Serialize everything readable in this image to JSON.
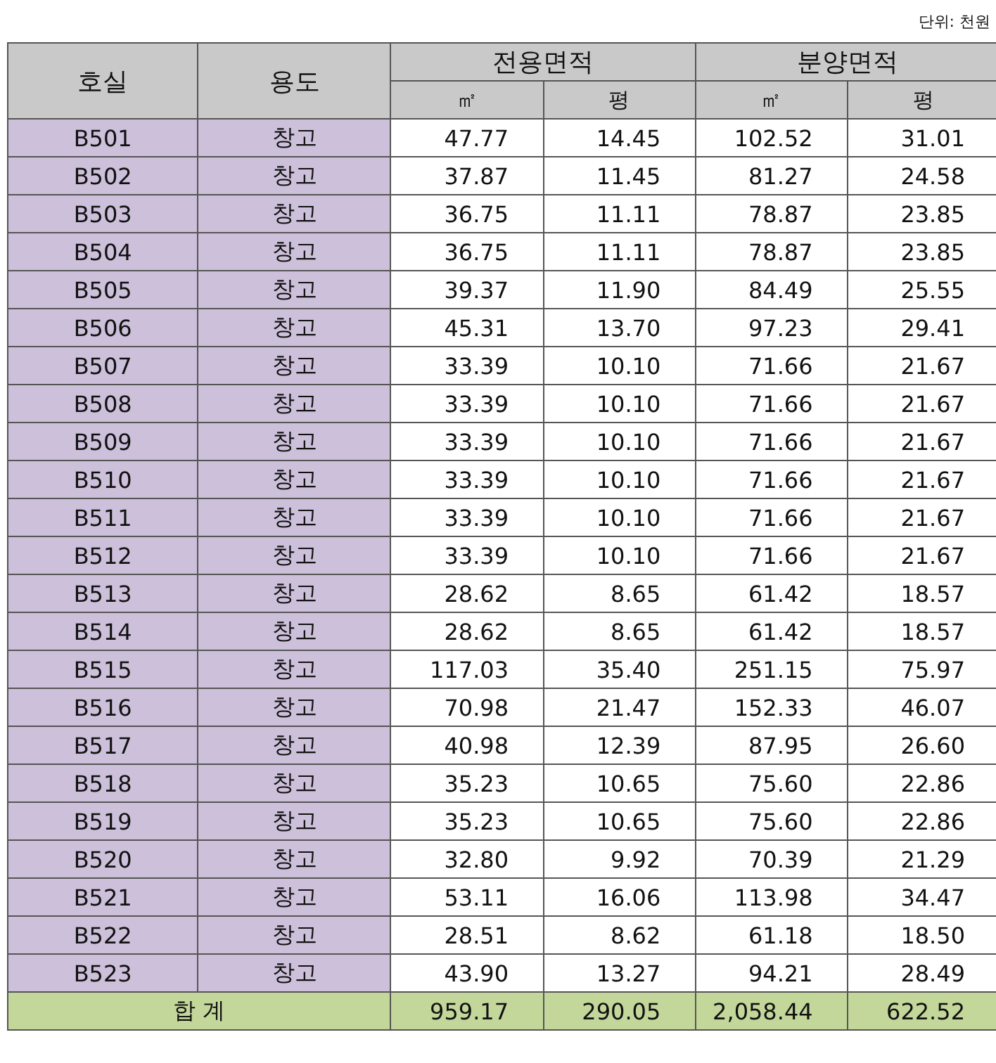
{
  "unit_note": "단위: 천원",
  "table": {
    "columns": [
      {
        "label": "호실"
      },
      {
        "label": "용도"
      },
      {
        "label": "전용면적",
        "subcolumns": [
          "㎡",
          "평"
        ]
      },
      {
        "label": "분양면적",
        "subcolumns": [
          "㎡",
          "평"
        ]
      }
    ],
    "rows": [
      {
        "room": "B501",
        "use": "창고",
        "values": [
          "47.77",
          "14.45",
          "102.52",
          "31.01"
        ]
      },
      {
        "room": "B502",
        "use": "창고",
        "values": [
          "37.87",
          "11.45",
          "81.27",
          "24.58"
        ]
      },
      {
        "room": "B503",
        "use": "창고",
        "values": [
          "36.75",
          "11.11",
          "78.87",
          "23.85"
        ]
      },
      {
        "room": "B504",
        "use": "창고",
        "values": [
          "36.75",
          "11.11",
          "78.87",
          "23.85"
        ]
      },
      {
        "room": "B505",
        "use": "창고",
        "values": [
          "39.37",
          "11.90",
          "84.49",
          "25.55"
        ]
      },
      {
        "room": "B506",
        "use": "창고",
        "values": [
          "45.31",
          "13.70",
          "97.23",
          "29.41"
        ]
      },
      {
        "room": "B507",
        "use": "창고",
        "values": [
          "33.39",
          "10.10",
          "71.66",
          "21.67"
        ]
      },
      {
        "room": "B508",
        "use": "창고",
        "values": [
          "33.39",
          "10.10",
          "71.66",
          "21.67"
        ]
      },
      {
        "room": "B509",
        "use": "창고",
        "values": [
          "33.39",
          "10.10",
          "71.66",
          "21.67"
        ]
      },
      {
        "room": "B510",
        "use": "창고",
        "values": [
          "33.39",
          "10.10",
          "71.66",
          "21.67"
        ]
      },
      {
        "room": "B511",
        "use": "창고",
        "values": [
          "33.39",
          "10.10",
          "71.66",
          "21.67"
        ]
      },
      {
        "room": "B512",
        "use": "창고",
        "values": [
          "33.39",
          "10.10",
          "71.66",
          "21.67"
        ]
      },
      {
        "room": "B513",
        "use": "창고",
        "values": [
          "28.62",
          "8.65",
          "61.42",
          "18.57"
        ]
      },
      {
        "room": "B514",
        "use": "창고",
        "values": [
          "28.62",
          "8.65",
          "61.42",
          "18.57"
        ]
      },
      {
        "room": "B515",
        "use": "창고",
        "values": [
          "117.03",
          "35.40",
          "251.15",
          "75.97"
        ]
      },
      {
        "room": "B516",
        "use": "창고",
        "values": [
          "70.98",
          "21.47",
          "152.33",
          "46.07"
        ]
      },
      {
        "room": "B517",
        "use": "창고",
        "values": [
          "40.98",
          "12.39",
          "87.95",
          "26.60"
        ]
      },
      {
        "room": "B518",
        "use": "창고",
        "values": [
          "35.23",
          "10.65",
          "75.60",
          "22.86"
        ]
      },
      {
        "room": "B519",
        "use": "창고",
        "values": [
          "35.23",
          "10.65",
          "75.60",
          "22.86"
        ]
      },
      {
        "room": "B520",
        "use": "창고",
        "values": [
          "32.80",
          "9.92",
          "70.39",
          "21.29"
        ]
      },
      {
        "room": "B521",
        "use": "창고",
        "values": [
          "53.11",
          "16.06",
          "113.98",
          "34.47"
        ]
      },
      {
        "room": "B522",
        "use": "창고",
        "values": [
          "28.51",
          "8.62",
          "61.18",
          "18.50"
        ]
      },
      {
        "room": "B523",
        "use": "창고",
        "values": [
          "43.90",
          "13.27",
          "94.21",
          "28.49"
        ]
      }
    ],
    "total": {
      "label": "합 계",
      "values": [
        "959.17",
        "290.05",
        "2,058.44",
        "622.52"
      ]
    }
  }
}
